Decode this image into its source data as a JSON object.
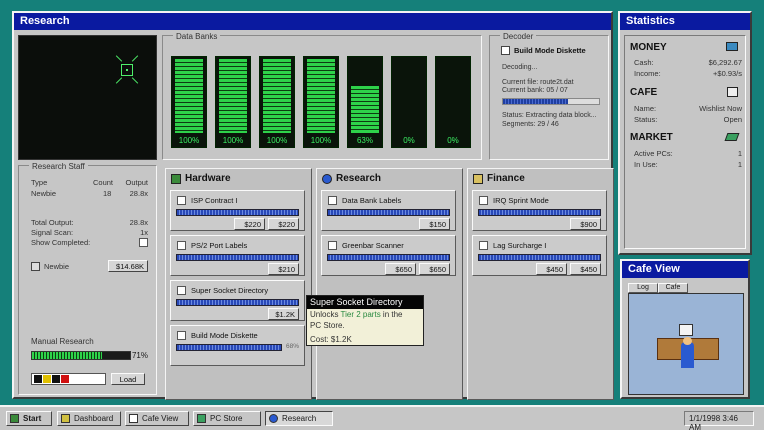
{
  "research_window": {
    "title": "Research",
    "data_banks": {
      "label": "Data Banks",
      "banks": [
        {
          "pct_label": "100%",
          "level": 100
        },
        {
          "pct_label": "100%",
          "level": 100
        },
        {
          "pct_label": "100%",
          "level": 100
        },
        {
          "pct_label": "100%",
          "level": 100
        },
        {
          "pct_label": "63%",
          "level": 63
        },
        {
          "pct_label": "0%",
          "level": 0
        },
        {
          "pct_label": "0%",
          "level": 0
        }
      ]
    },
    "decoder": {
      "label": "Decoder",
      "item": "Build Mode Diskette",
      "status_line": "Decoding...",
      "current_file": "Current file: route2t.dat",
      "current_bank": "Current bank: 05 / 07",
      "progress": 0.68,
      "status": "Status: Extracting data block...",
      "segments": "Segments: 29 / 46"
    },
    "staff": {
      "label": "Research Staff",
      "col_type": "Type",
      "col_count": "Count",
      "col_output": "Output",
      "rows": [
        {
          "type": "Newbie",
          "count": "18",
          "output": "28.8x"
        }
      ],
      "total_output_label": "Total Output:",
      "total_output": "28.8x",
      "signal_scan_label": "Signal Scan:",
      "signal_scan": "1x",
      "show_completed_label": "Show Completed:",
      "hire_label": "Newbie",
      "hire_price": "$14.68K",
      "manual_label": "Manual Research",
      "manual_pct": "71%",
      "manual_level": 0.71,
      "load_label": "Load"
    },
    "columns": [
      {
        "title": "Hardware",
        "cards": [
          {
            "name": "ISP Contract I",
            "prices": [
              "$220",
              "$220"
            ]
          },
          {
            "name": "PS/2 Port Labels",
            "prices": [
              "$210"
            ]
          },
          {
            "name": "Super Socket Directory",
            "prices": [
              "$1.2K"
            ]
          },
          {
            "name": "Build Mode Diskette",
            "progress_label": "68%"
          }
        ]
      },
      {
        "title": "Research",
        "cards": [
          {
            "name": "Data Bank Labels",
            "prices": [
              "$150"
            ]
          },
          {
            "name": "Greenbar Scanner",
            "prices": [
              "$650",
              "$650"
            ]
          }
        ]
      },
      {
        "title": "Finance",
        "cards": [
          {
            "name": "IRQ Sprint Mode",
            "prices": [
              "$900"
            ]
          },
          {
            "name": "Lag Surcharge I",
            "prices": [
              "$450",
              "$450"
            ]
          }
        ]
      }
    ],
    "tooltip": {
      "title": "Super Socket Directory",
      "line1_a": "Unlocks ",
      "line1_b": "Tier 2 parts",
      "line1_c": " in the",
      "line2": "PC Store.",
      "cost": "Cost: $1.2K"
    }
  },
  "statistics": {
    "title": "Statistics",
    "money": {
      "heading": "MONEY",
      "cash_label": "Cash:",
      "cash": "$6,292.67",
      "income_label": "Income:",
      "income": "+$0.93/s"
    },
    "cafe": {
      "heading": "CAFE",
      "name_label": "Name:",
      "name": "Wishlist Now",
      "status_label": "Status:",
      "status": "Open"
    },
    "market": {
      "heading": "MARKET",
      "active_label": "Active PCs:",
      "active": "1",
      "inuse_label": "In Use:",
      "inuse": "1"
    }
  },
  "cafe_view": {
    "title": "Cafe View",
    "tabs": [
      "Log",
      "Cafe"
    ]
  },
  "taskbar": {
    "start": "Start",
    "items": [
      "Dashboard",
      "Cafe View",
      "PC Store",
      "Research"
    ],
    "active": "Research",
    "clock": "1/1/1998 3:46 AM"
  },
  "colors": {
    "title_bar": "#0a1aa0",
    "bank_green": "#2ed24a",
    "progress_blue": "#2848b8",
    "desktop": "#15807a"
  }
}
